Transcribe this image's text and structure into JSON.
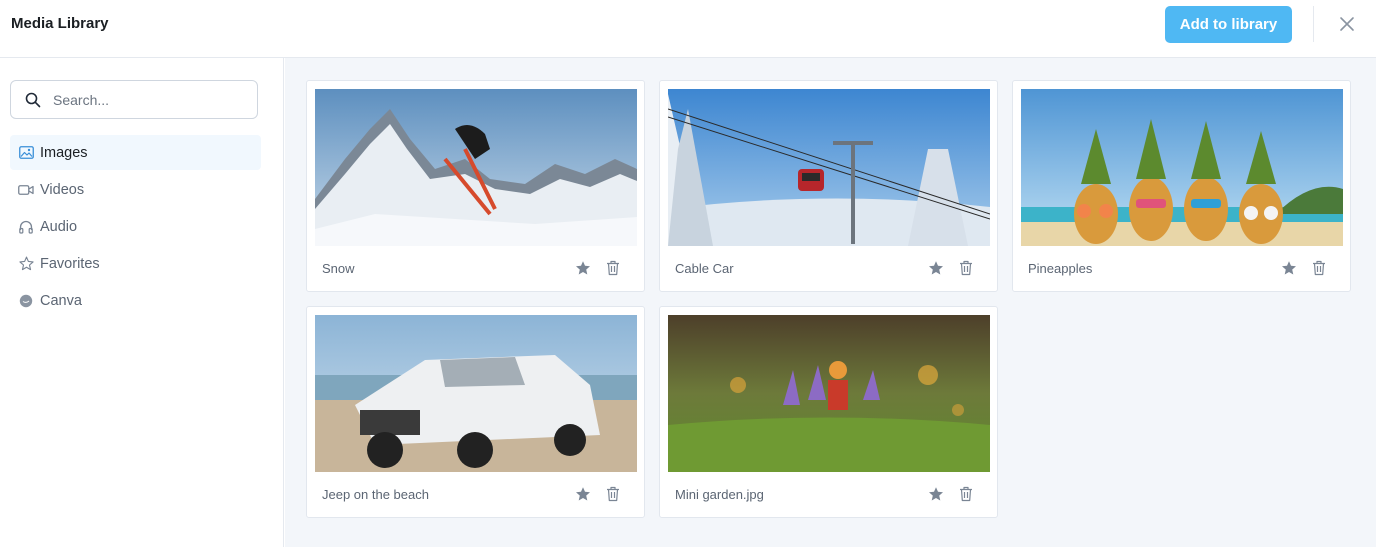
{
  "header": {
    "title": "Media Library",
    "add_button": "Add to library",
    "close_icon": "close-icon"
  },
  "sidebar": {
    "search_placeholder": "Search...",
    "items": [
      {
        "label": "Images",
        "icon": "image-icon",
        "active": true
      },
      {
        "label": "Videos",
        "icon": "video-icon",
        "active": false
      },
      {
        "label": "Audio",
        "icon": "headphones-icon",
        "active": false
      },
      {
        "label": "Favorites",
        "icon": "star-icon",
        "active": false
      },
      {
        "label": "Canva",
        "icon": "canva-icon",
        "active": false
      }
    ]
  },
  "media": [
    {
      "label": "Snow"
    },
    {
      "label": "Cable Car"
    },
    {
      "label": "Pineapples"
    },
    {
      "label": "Jeep on the beach"
    },
    {
      "label": "Mini garden.jpg"
    }
  ],
  "colors": {
    "accent": "#4fb8f3",
    "active_nav_bg": "#f1f8fe",
    "main_bg": "#f3f6fa",
    "icon_gray": "#7a8594"
  }
}
